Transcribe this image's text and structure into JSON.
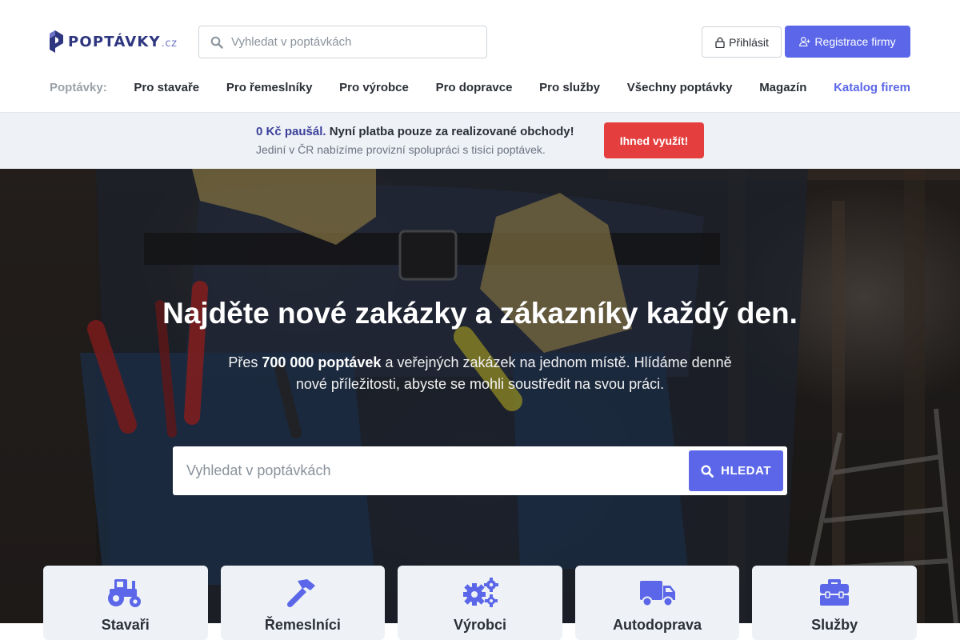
{
  "colors": {
    "brand": "#2f3680",
    "accent": "#5b67e8",
    "danger": "#e53e3e",
    "promo_bg": "#eef2f6",
    "card_icon": "#5b67e8"
  },
  "header": {
    "logo_text": "POPTÁVKY",
    "logo_tld": ".cz",
    "logo_icon": "poptavky-logo-mark",
    "search": {
      "placeholder": "Vyhledat v poptávkách",
      "value": "",
      "icon": "search-icon"
    },
    "login_button": {
      "label": "Přihlásit",
      "icon": "lock-icon"
    },
    "register_button": {
      "label": "Registrace firmy",
      "icon": "user-plus-icon"
    }
  },
  "nav": {
    "label": "Poptávky:",
    "items": [
      {
        "label": "Pro stavaře"
      },
      {
        "label": "Pro řemeslníky"
      },
      {
        "label": "Pro výrobce"
      },
      {
        "label": "Pro dopravce"
      },
      {
        "label": "Pro služby"
      },
      {
        "label": "Všechny poptávky"
      },
      {
        "label": "Magazín"
      },
      {
        "label": "Katalog firem"
      }
    ]
  },
  "promo": {
    "price": "0 Kč paušál.",
    "headline": "Nyní platba pouze za realizované obchody!",
    "subtext": "Jediní v ČR nabízíme provizní spolupráci s tisíci poptávek.",
    "button": "Ihned využít!"
  },
  "hero": {
    "title": "Najděte nové zakázky a zákazníky každý den.",
    "sub_prefix": "Přes",
    "sub_bold": "700 000 poptávek",
    "sub_rest": "a veřejných zakázek na jednom místě. Hlídáme denně nové příležitosti, abyste se mohli soustředit na svou práci.",
    "search": {
      "placeholder": "Vyhledat v poptávkách",
      "value": "",
      "button": "HLEDAT",
      "icon": "search-icon"
    }
  },
  "categories": [
    {
      "label": "Stavaři",
      "icon": "tractor-icon"
    },
    {
      "label": "Řemeslníci",
      "icon": "hammer-icon"
    },
    {
      "label": "Výrobci",
      "icon": "cogs-icon"
    },
    {
      "label": "Autodoprava",
      "icon": "truck-icon"
    },
    {
      "label": "Služby",
      "icon": "toolbox-icon"
    }
  ]
}
